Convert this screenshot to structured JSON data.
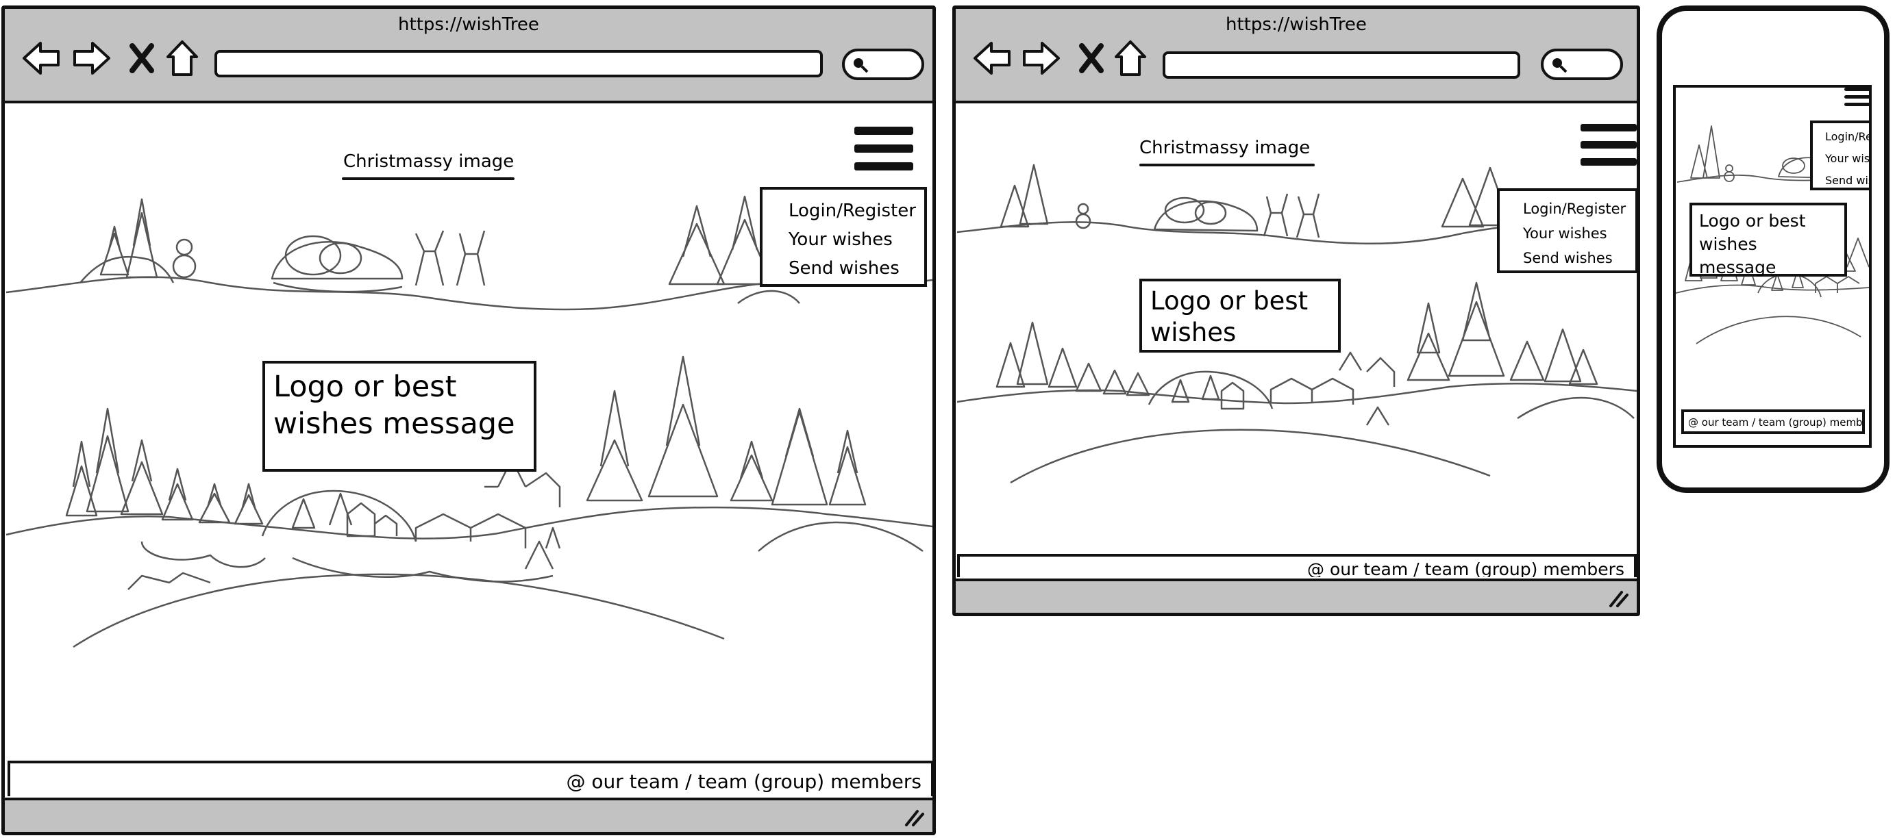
{
  "url": "https://wishTree",
  "caption": "Christmassy image",
  "menu_items": [
    "Login/Register",
    "Your wishes",
    "Send wishes"
  ],
  "desktop": {
    "logo_text": "Logo or best wishes message"
  },
  "tablet": {
    "logo_text": "Logo or best wishes"
  },
  "mobile": {
    "logo_text": "Logo or best wishes message",
    "menu_items": [
      "Login/Re",
      "Your wish",
      "Send wis"
    ]
  },
  "footer_text": "@ our team / team (group) members",
  "icons": [
    "back-arrow-icon",
    "forward-arrow-icon",
    "close-icon",
    "home-icon",
    "search-icon",
    "hamburger-menu-icon",
    "resize-grip-icon"
  ]
}
